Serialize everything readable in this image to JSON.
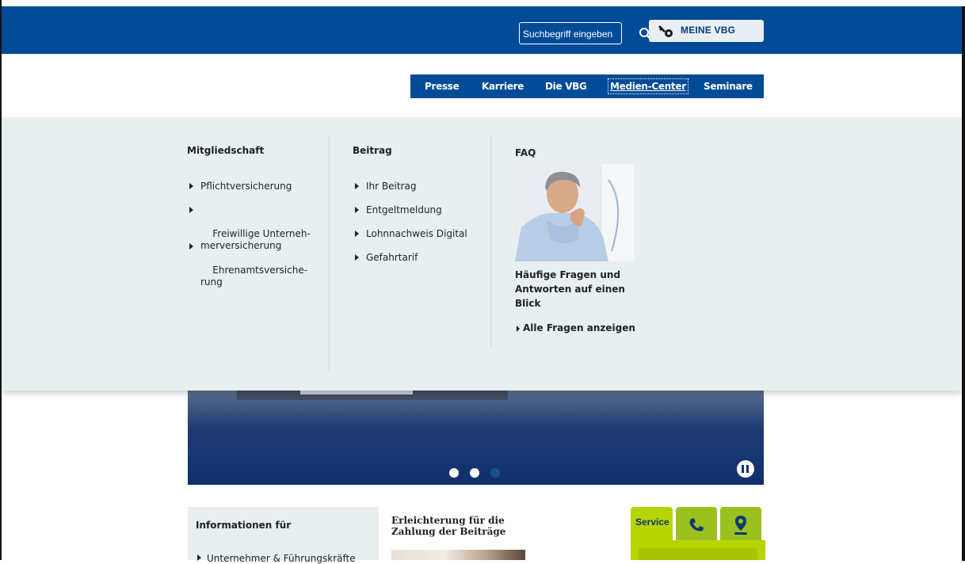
{
  "header": {
    "search_placeholder": "Suchbegriff eingeben",
    "meine_vbg_label": "MEINE VBG"
  },
  "nav": {
    "items": [
      {
        "label": "Presse"
      },
      {
        "label": "Karriere"
      },
      {
        "label": "Die VBG"
      },
      {
        "label": "Medien-Center"
      },
      {
        "label": "Seminare"
      }
    ]
  },
  "mega_menu": {
    "col1": {
      "title": "Mitgliedschaft",
      "items": [
        "Pflichtversicherung",
        "Freiwillige Unterneh-\nmerversicherung",
        "Ehrenamtsversiche-\nrung"
      ]
    },
    "col2": {
      "title": "Beitrag",
      "items": [
        "Ihr Beitrag",
        "Entgeltmeldung",
        "Lohnnachweis Digital",
        "Gefahrtarif"
      ]
    },
    "col3": {
      "title": "FAQ",
      "text": "Häufige Fragen und Antworten auf einen Blick",
      "link": "Alle Fragen anzeigen"
    }
  },
  "carousel": {
    "slide_count": 3,
    "active_index": 2
  },
  "info": {
    "title": "Informationen für",
    "item": "Unternehmer & Führungskräfte"
  },
  "news": {
    "title": "Erleichterung für die Zahlung der Beiträge"
  },
  "service": {
    "tab_label": "Service",
    "icons": [
      "phone-icon",
      "location-pin-icon"
    ]
  },
  "colors": {
    "brand_blue": "#004b97",
    "menu_bg": "#e8f0ef",
    "service_green": "#b6d400"
  }
}
